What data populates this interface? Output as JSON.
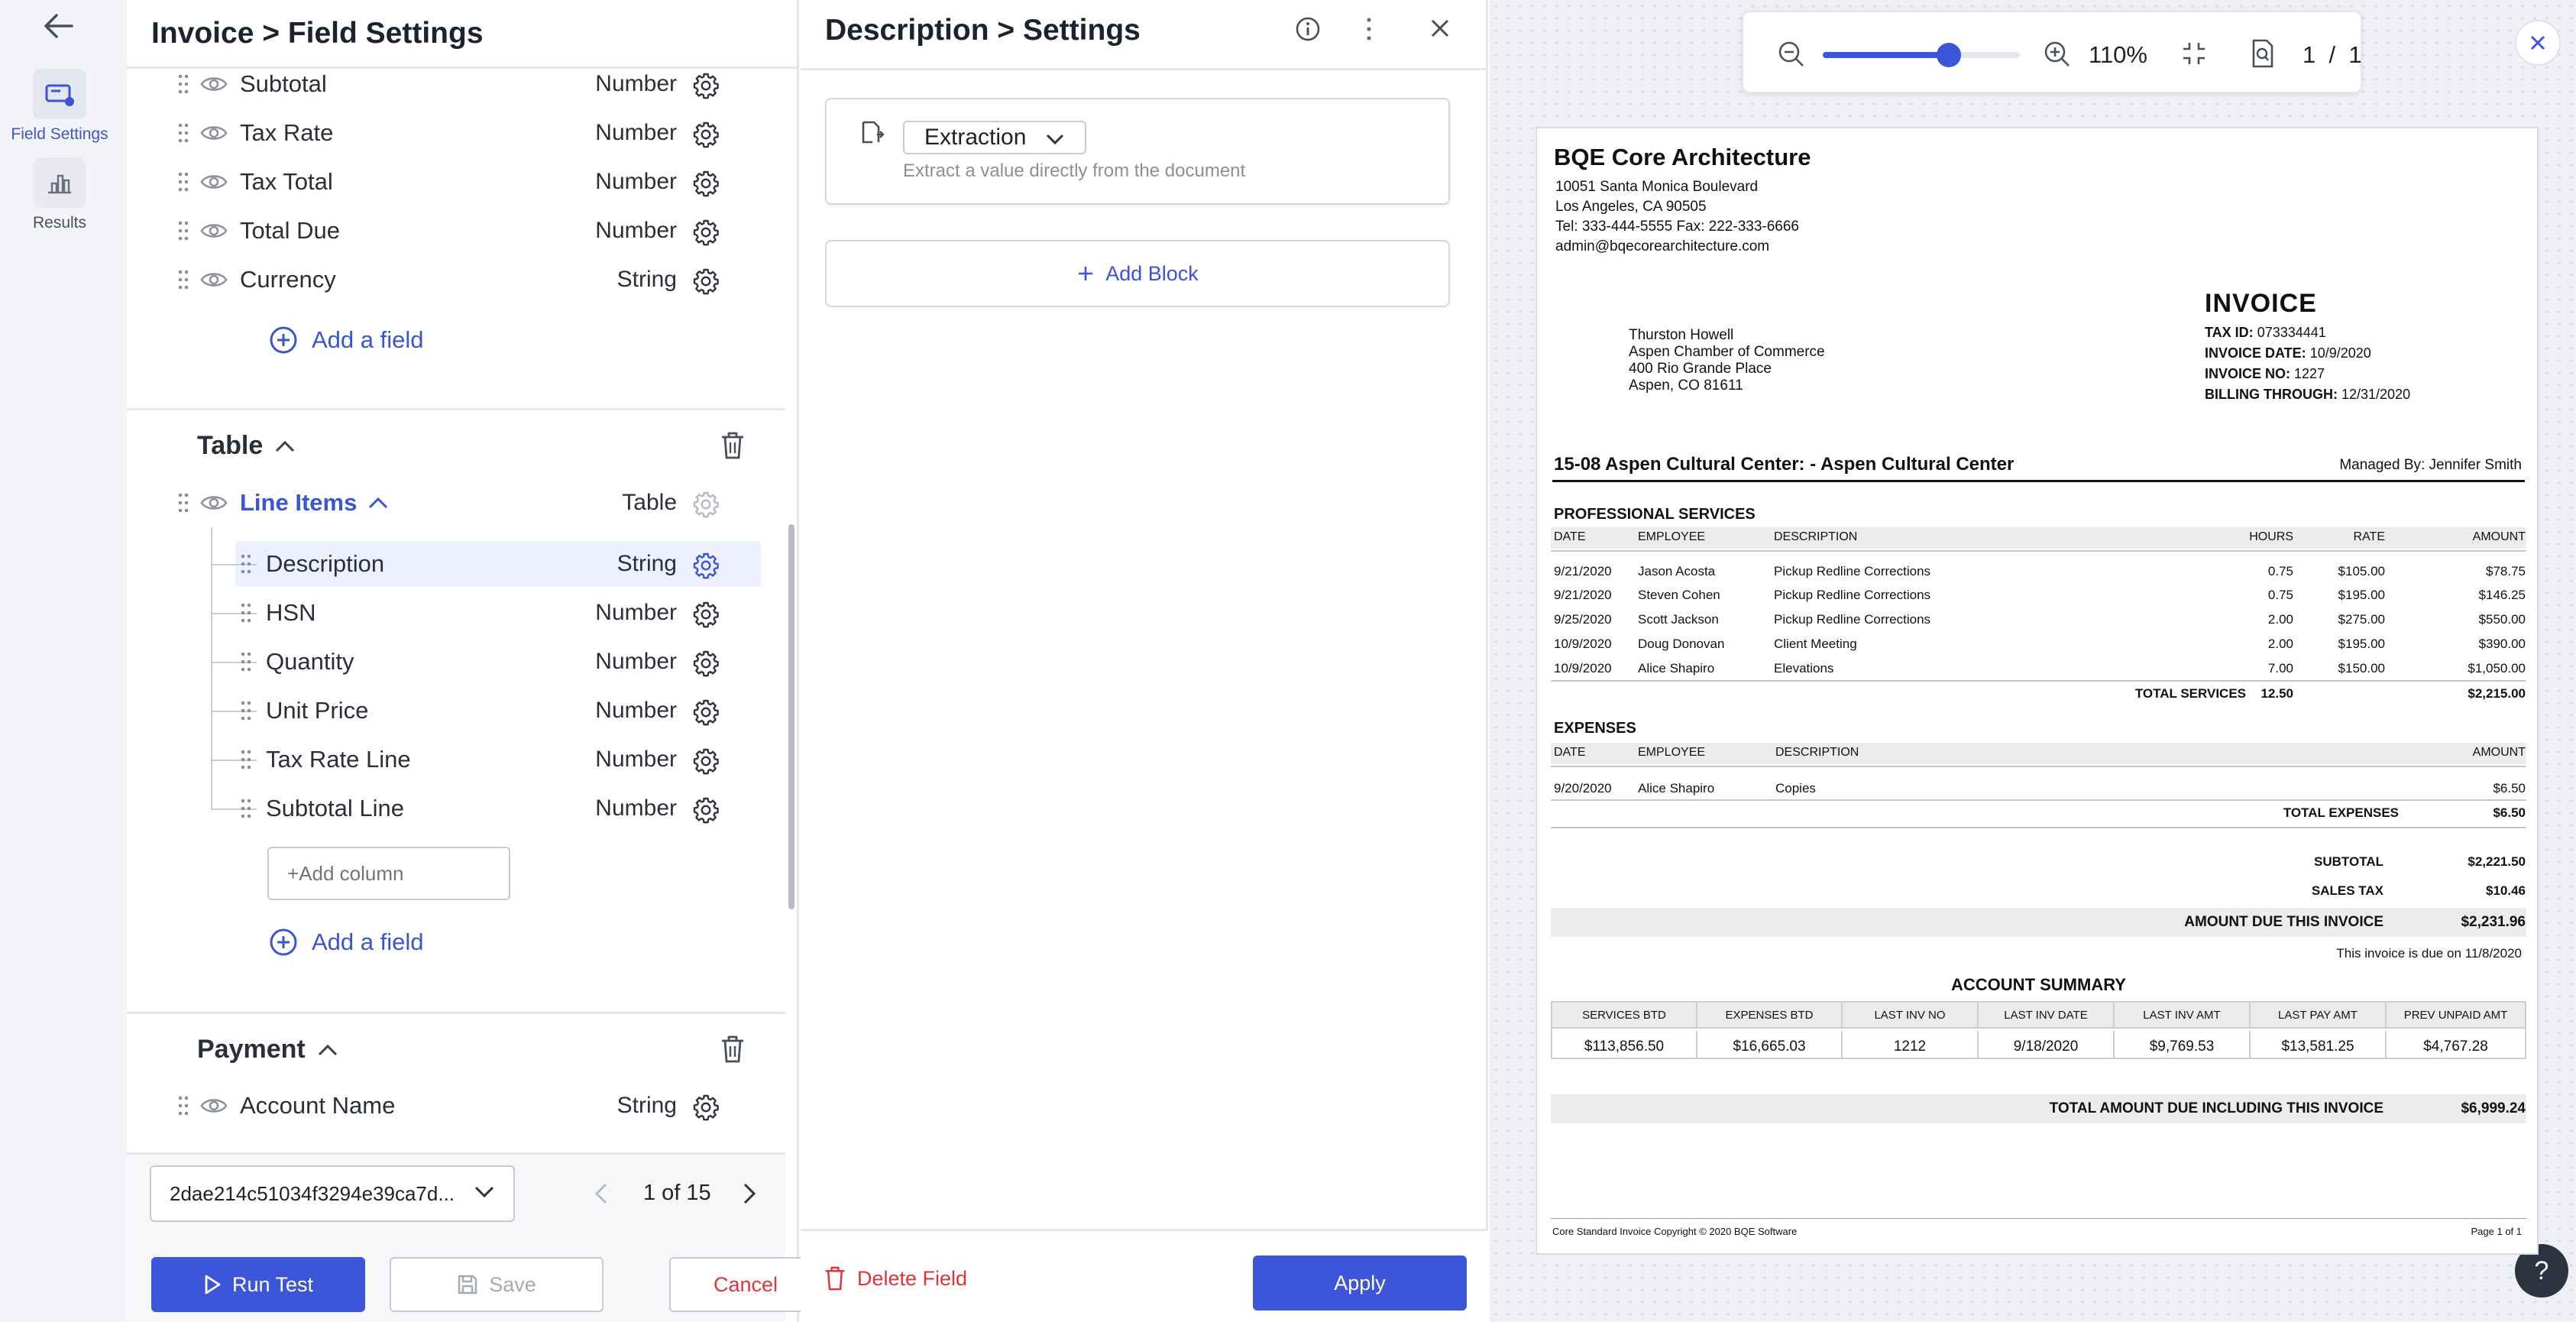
{
  "rail": {
    "items": [
      {
        "label": "Field Settings",
        "icon": "field-settings-icon",
        "active": true
      },
      {
        "label": "Results",
        "icon": "results-icon",
        "active": false
      }
    ]
  },
  "field_panel": {
    "title": "Invoice > Field Settings",
    "summary_fields": [
      {
        "name": "Subtotal",
        "type": "Number"
      },
      {
        "name": "Tax Rate",
        "type": "Number"
      },
      {
        "name": "Tax Total",
        "type": "Number"
      },
      {
        "name": "Total Due",
        "type": "Number"
      },
      {
        "name": "Currency",
        "type": "String"
      }
    ],
    "add_field_label": "Add a field",
    "table_section": {
      "title": "Table",
      "group": {
        "name": "Line Items",
        "type": "Table"
      },
      "columns": [
        {
          "name": "Description",
          "type": "String"
        },
        {
          "name": "HSN",
          "type": "Number"
        },
        {
          "name": "Quantity",
          "type": "Number"
        },
        {
          "name": "Unit Price",
          "type": "Number"
        },
        {
          "name": "Tax Rate Line",
          "type": "Number"
        },
        {
          "name": "Subtotal Line",
          "type": "Number"
        }
      ],
      "add_column_placeholder": "+Add column"
    },
    "payment_section": {
      "title": "Payment",
      "fields": [
        {
          "name": "Account Name",
          "type": "String"
        }
      ]
    },
    "document_select": "2dae214c51034f3294e39ca7d...",
    "pager": "1 of 15",
    "run_test_label": "Run Test",
    "save_label": "Save",
    "cancel_label": "Cancel"
  },
  "settings_panel": {
    "title": "Description > Settings",
    "block": {
      "type": "Extraction",
      "description": "Extract a value directly from the document"
    },
    "add_block_label": "Add Block",
    "delete_label": "Delete Field",
    "apply_label": "Apply"
  },
  "preview": {
    "zoom": "110%",
    "page_current": "1",
    "page_sep": "/",
    "page_total": "1",
    "zoom_fraction": 0.64,
    "help_label": "?"
  },
  "invoice": {
    "company": "BQE Core Architecture",
    "company_lines": [
      "10051 Santa Monica Boulevard",
      "Los Angeles, CA 90505",
      "Tel: 333-444-5555 Fax: 222-333-6666",
      "admin@bqecorearchitecture.com"
    ],
    "bill_to": [
      "Thurston Howell",
      "Aspen Chamber of Commerce",
      "400 Rio Grande Place",
      "Aspen, CO  81611"
    ],
    "heading": "INVOICE",
    "meta": [
      {
        "label": "TAX ID:",
        "value": "073334441"
      },
      {
        "label": "INVOICE DATE:",
        "value": "10/9/2020"
      },
      {
        "label": "INVOICE NO:",
        "value": "1227"
      },
      {
        "label": "BILLING THROUGH:",
        "value": "12/31/2020"
      }
    ],
    "project": "15-08 Aspen Cultural Center: - Aspen Cultural Center",
    "managed_by": "Managed By: Jennifer  Smith",
    "services_title": "PROFESSIONAL SERVICES",
    "services_headers": [
      "DATE",
      "EMPLOYEE",
      "DESCRIPTION",
      "HOURS",
      "RATE",
      "AMOUNT"
    ],
    "services": [
      [
        "9/21/2020",
        "Jason Acosta",
        "Pickup Redline Corrections",
        "0.75",
        "$105.00",
        "$78.75"
      ],
      [
        "9/21/2020",
        "Steven Cohen",
        "Pickup Redline Corrections",
        "0.75",
        "$195.00",
        "$146.25"
      ],
      [
        "9/25/2020",
        "Scott Jackson",
        "Pickup Redline Corrections",
        "2.00",
        "$275.00",
        "$550.00"
      ],
      [
        "10/9/2020",
        "Doug Donovan",
        "Client Meeting",
        "2.00",
        "$195.00",
        "$390.00"
      ],
      [
        "10/9/2020",
        "Alice Shapiro",
        "Elevations",
        "7.00",
        "$150.00",
        "$1,050.00"
      ]
    ],
    "total_services": {
      "label": "TOTAL SERVICES",
      "hours": "12.50",
      "amount": "$2,215.00"
    },
    "expenses_title": "EXPENSES",
    "expenses_headers": [
      "DATE",
      "EMPLOYEE",
      "DESCRIPTION",
      "AMOUNT"
    ],
    "expenses": [
      [
        "9/20/2020",
        "Alice Shapiro",
        "Copies",
        "$6.50"
      ]
    ],
    "total_expenses": {
      "label": "TOTAL EXPENSES",
      "amount": "$6.50"
    },
    "subtotal": {
      "label": "SUBTOTAL",
      "amount": "$2,221.50"
    },
    "sales_tax": {
      "label": "SALES TAX",
      "amount": "$10.46"
    },
    "amount_due": {
      "label": "AMOUNT DUE THIS INVOICE",
      "amount": "$2,231.96"
    },
    "due_note": "This invoice is due on 11/8/2020",
    "summary_title": "ACCOUNT SUMMARY",
    "summary_headers": [
      "SERVICES BTD",
      "EXPENSES BTD",
      "LAST INV NO",
      "LAST INV DATE",
      "LAST INV AMT",
      "LAST PAY AMT",
      "PREV UNPAID AMT"
    ],
    "summary_values": [
      "$113,856.50",
      "$16,665.03",
      "1212",
      "9/18/2020",
      "$9,769.53",
      "$13,581.25",
      "$4,767.28"
    ],
    "grand_total": {
      "label": "TOTAL AMOUNT DUE INCLUDING THIS INVOICE",
      "amount": "$6,999.24"
    },
    "footer_left": "Core Standard Invoice Copyright © 2020 BQE Software",
    "footer_right": "Page 1 of 1"
  },
  "colors": {
    "accent": "#3d55d8",
    "danger": "#d9363e",
    "selected_row": "#eef1fd"
  }
}
